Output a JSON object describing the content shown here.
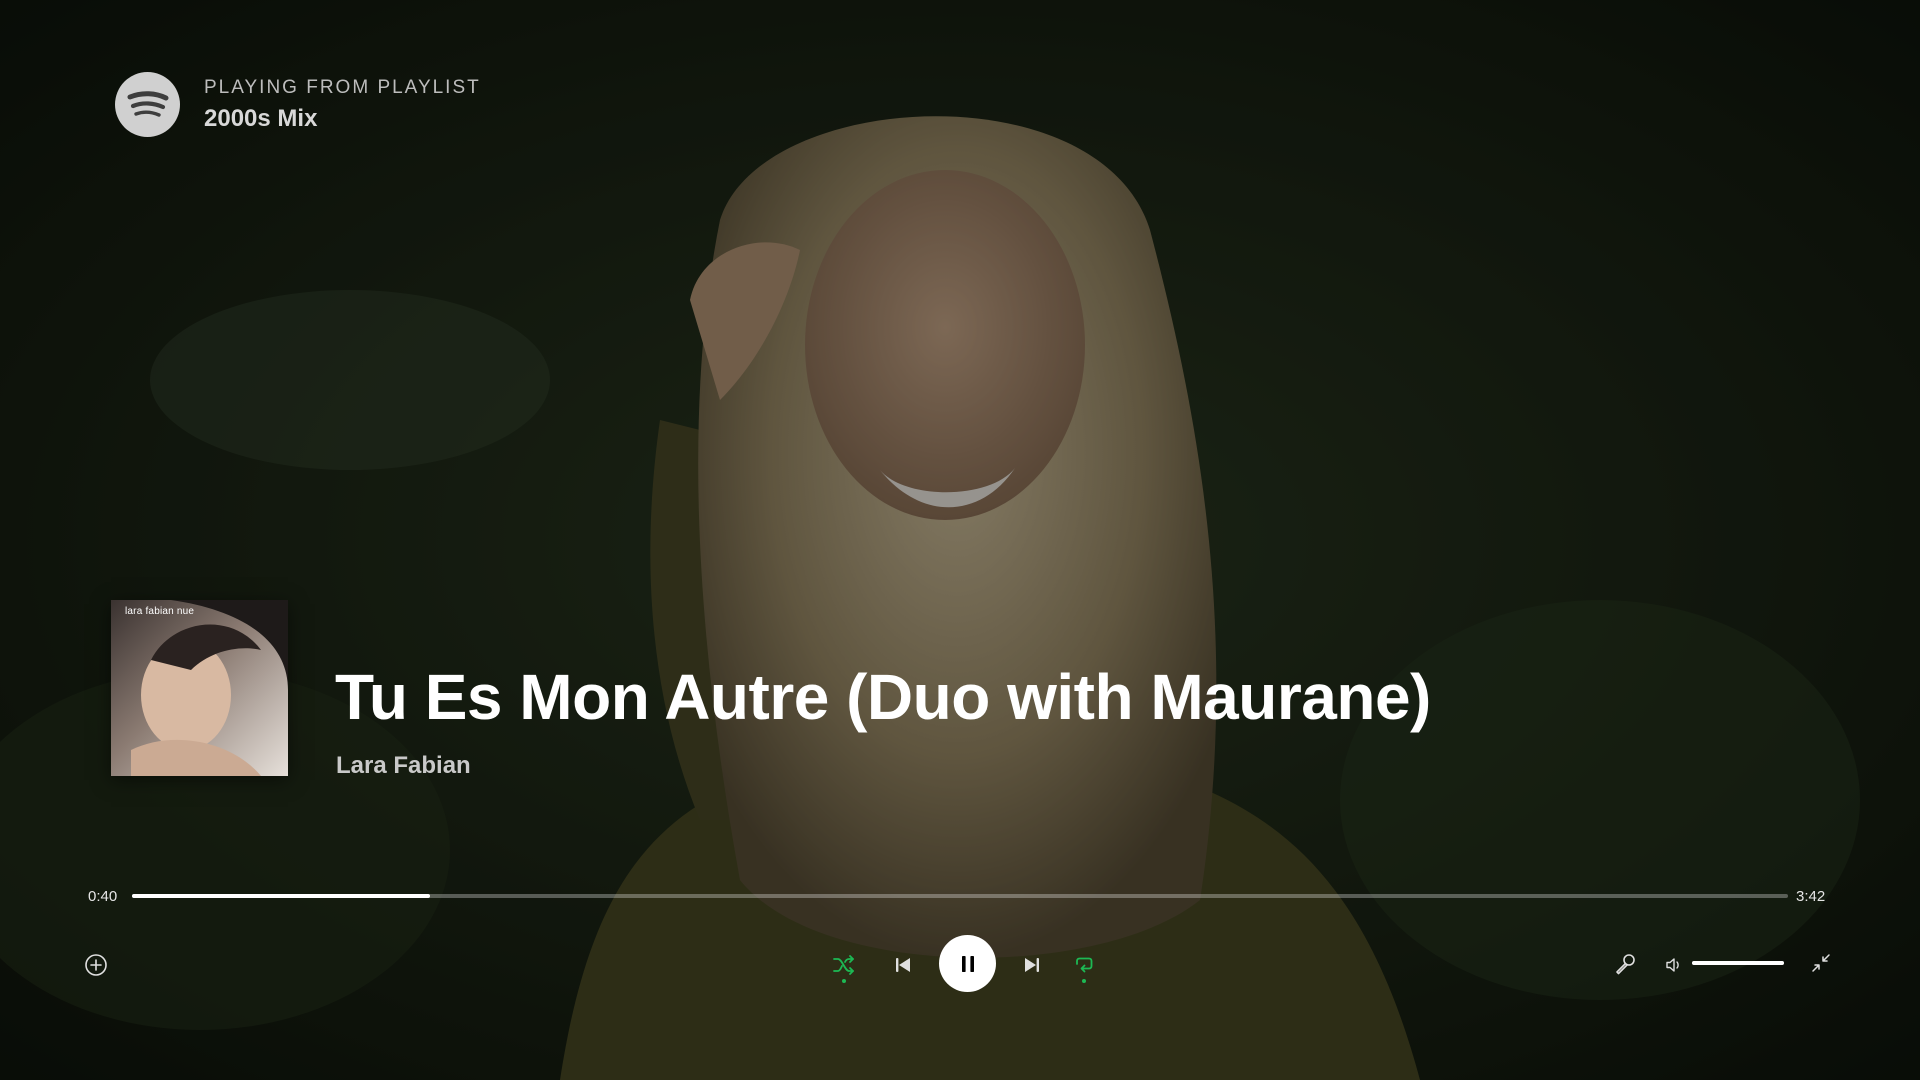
{
  "header": {
    "label": "PLAYING FROM PLAYLIST",
    "playlist": "2000s Mix"
  },
  "track": {
    "title": "Tu Es Mon Autre (Duo with Maurane)",
    "artist": "Lara Fabian",
    "cover_text": "lara fabian nue"
  },
  "progress": {
    "current": "0:40",
    "total": "3:42",
    "fraction": 0.18
  },
  "volume": {
    "fraction": 1.0
  },
  "controls": {
    "shuffle_active": true,
    "repeat_active": true,
    "playing": true
  },
  "icons": {
    "logo": "spotify-logo-icon",
    "add": "add-circle-icon",
    "shuffle": "shuffle-icon",
    "previous": "skip-previous-icon",
    "pause": "pause-icon",
    "next": "skip-next-icon",
    "repeat": "repeat-icon",
    "lyrics": "microphone-icon",
    "volume": "volume-icon",
    "exit_fullscreen": "exit-fullscreen-icon"
  },
  "colors": {
    "accent": "#1db954",
    "text": "#ffffff",
    "muted": "#c9c9c9"
  }
}
